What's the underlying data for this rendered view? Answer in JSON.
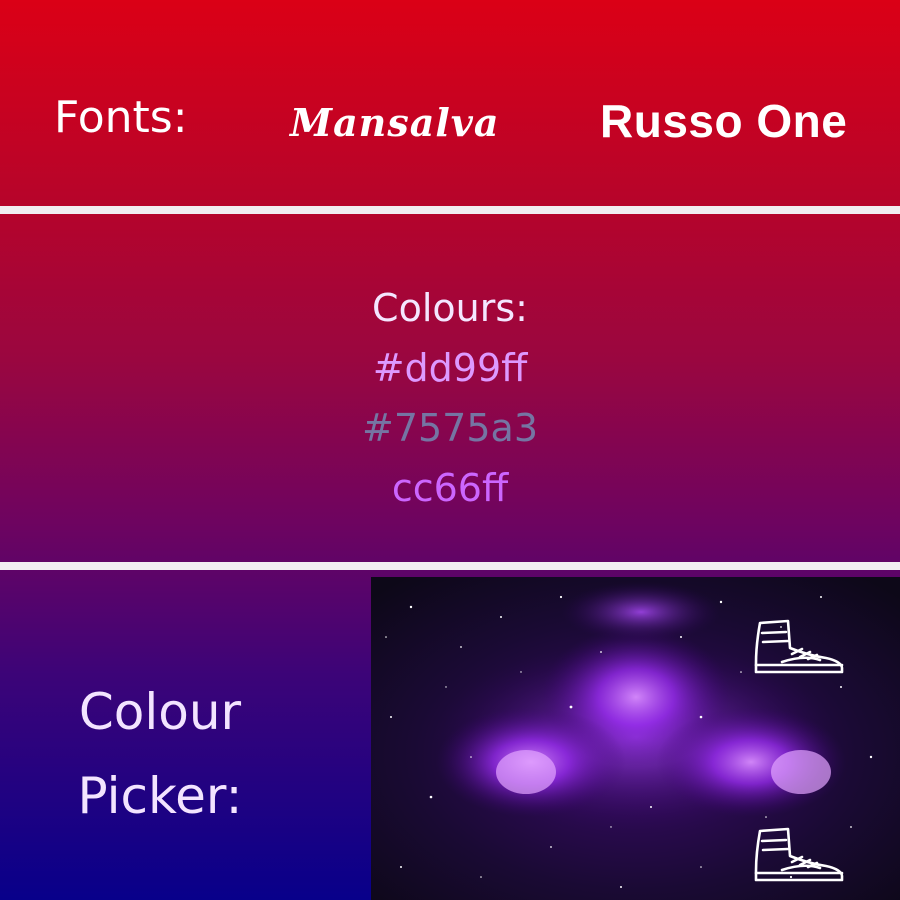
{
  "fonts": {
    "label": "Fonts:",
    "samples": [
      "Mansalva",
      "Russo One"
    ]
  },
  "colours": {
    "label": "Colours:",
    "swatches": [
      {
        "text": "#dd99ff",
        "color": "#dd99ff"
      },
      {
        "text": "#7575a3",
        "color": "#7575a3"
      },
      {
        "text": "cc66ff",
        "color": "#cc66ff"
      }
    ]
  },
  "picker": {
    "label_line1": "Colour",
    "label_line2": "Picker:",
    "image_icon": "sneaker-icon"
  },
  "theme": {
    "gradient_top": "#db0016",
    "gradient_bottom": "#08008a",
    "divider": "#f1eef2",
    "galaxy": "#8a1cf0"
  }
}
